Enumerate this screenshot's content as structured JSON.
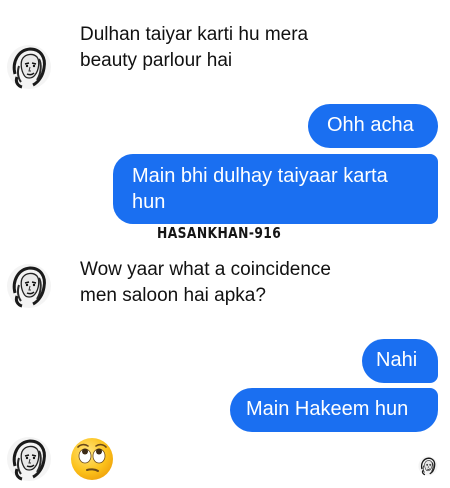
{
  "messages": {
    "m1": {
      "line1": "Dulhan taiyar karti hu mera",
      "line2": "beauty parlour hai"
    },
    "m2": {
      "text": "Ohh acha"
    },
    "m3": {
      "line1": "Main bhi dulhay taiyaar karta",
      "line2": "hun"
    },
    "m4": {
      "line1": "Wow yaar what a coincidence",
      "line2": "men saloon hai apka?"
    },
    "m5": {
      "text": "Nahi"
    },
    "m6": {
      "text": "Main Hakeem hun"
    }
  },
  "watermark": "HASANKHAN-916",
  "icons": {
    "avatar": "woman-sketch-avatar-icon",
    "reaction": "face-with-rolling-eyes-emoji",
    "seen": "seen-avatar-icon"
  },
  "colors": {
    "outgoing_bubble": "#1a6ff1",
    "outgoing_text": "#ffffff",
    "incoming_text": "#111111",
    "background": "#ffffff"
  }
}
